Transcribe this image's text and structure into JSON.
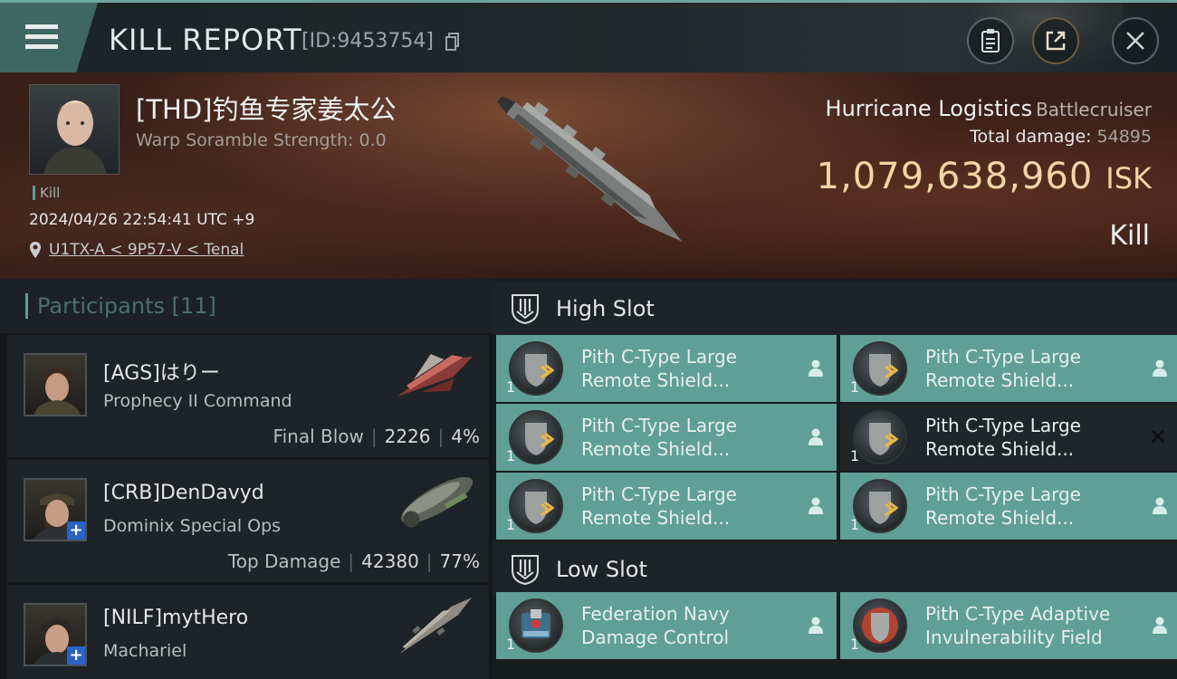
{
  "header": {
    "title": "KILL REPORT",
    "report_id": "[ID:9453754]",
    "icons": [
      "menu-icon",
      "copy-icon",
      "clipboard-icon",
      "share-icon",
      "close-icon"
    ]
  },
  "victim": {
    "pilot_name": "[THD]钓鱼专家姜太公",
    "warp_scramble": "Warp Soramble Strength: 0.0",
    "tag": "Kill",
    "datetime": "2024/04/26 22:54:41 UTC +9",
    "location": "U1TX-A < 9P57-V < Tenal",
    "ship_name": "Hurricane Logistics",
    "ship_class": "Battlecruiser",
    "total_damage_label": "Total damage:",
    "total_damage": "54895",
    "isk_value": "1,079,638,960",
    "isk_unit": "ISK",
    "result": "Kill"
  },
  "participants": {
    "title": "Participants [11]",
    "rows": [
      {
        "name": "[AGS]はりー",
        "ship": "Prophecy II Command",
        "role": "Final Blow",
        "damage": "2226",
        "percent": "4%"
      },
      {
        "name": "[CRB]DenDavyd",
        "ship": "Dominix Special Ops",
        "role": "Top Damage",
        "damage": "42380",
        "percent": "77%"
      },
      {
        "name": "[NILF]mytHero",
        "ship": "Machariel",
        "role": "",
        "damage": "",
        "percent": ""
      }
    ]
  },
  "slots": {
    "high": {
      "title": "High Slot",
      "modules": [
        {
          "name": "Pith C-Type Large Remote Shield...",
          "qty": "1"
        },
        {
          "name": "Pith C-Type Large Remote Shield...",
          "qty": "1"
        },
        {
          "name": "Pith C-Type Large Remote Shield...",
          "qty": "1"
        },
        {
          "name": "Pith C-Type Large Remote Shield...",
          "qty": "1"
        },
        {
          "name": "Pith C-Type Large Remote Shield...",
          "qty": "1"
        },
        {
          "name": "Pith C-Type Large Remote Shield...",
          "qty": "1"
        }
      ]
    },
    "low": {
      "title": "Low Slot",
      "modules": [
        {
          "name": "Federation Navy Damage Control",
          "qty": "1"
        },
        {
          "name": "Pith C-Type Adaptive Invulnerability Field",
          "qty": "1"
        }
      ]
    }
  },
  "colors": {
    "accent": "#5f9f97",
    "isk": "#f0d6a5",
    "banner": "#3b2019"
  }
}
